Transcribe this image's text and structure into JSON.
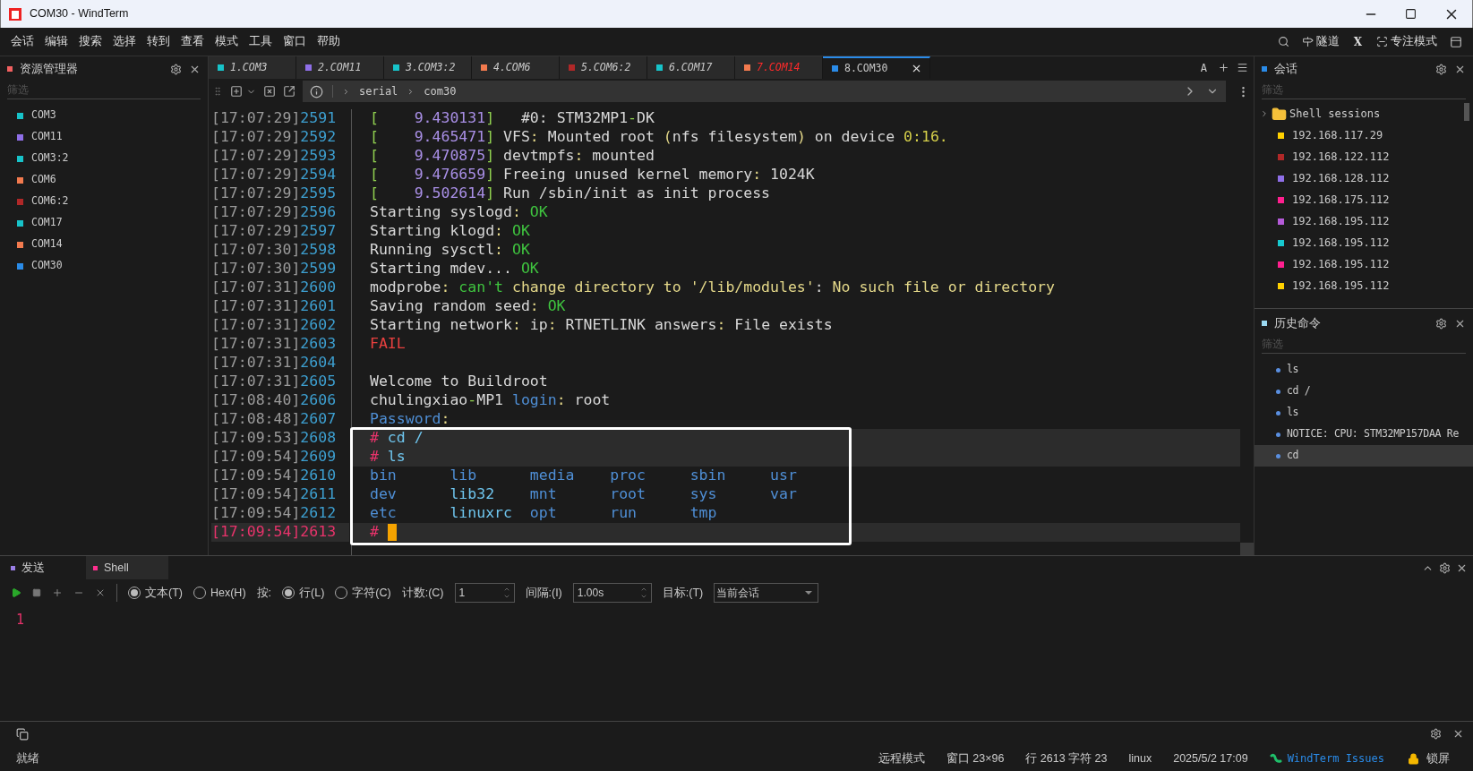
{
  "window": {
    "title": "COM30 - WindTerm"
  },
  "menu": [
    "会话",
    "编辑",
    "搜索",
    "选择",
    "转到",
    "查看",
    "模式",
    "工具",
    "窗口",
    "帮助"
  ],
  "menu_right": {
    "tunnel": "隧道",
    "x_label": "X",
    "focus_mode": "专注模式"
  },
  "explorer": {
    "title": "资源管理器",
    "filter_placeholder": "筛选",
    "items": [
      {
        "label": "COM3",
        "color": "#17c3c9"
      },
      {
        "label": "COM11",
        "color": "#8f6fe8"
      },
      {
        "label": "COM3:2",
        "color": "#17c3c9"
      },
      {
        "label": "COM6",
        "color": "#f27a4e"
      },
      {
        "label": "COM6:2",
        "color": "#b02828"
      },
      {
        "label": "COM17",
        "color": "#17c3c9"
      },
      {
        "label": "COM14",
        "color": "#f27a4e"
      },
      {
        "label": "COM30",
        "color": "#2a8be8"
      }
    ]
  },
  "tabs": [
    {
      "label": "1.COM3",
      "color": "#17c3c9",
      "selected": false,
      "alert": false
    },
    {
      "label": "2.COM11",
      "color": "#8f6fe8",
      "selected": false,
      "alert": false
    },
    {
      "label": "3.COM3:2",
      "color": "#17c3c9",
      "selected": false,
      "alert": false
    },
    {
      "label": "4.COM6",
      "color": "#f27a4e",
      "selected": false,
      "alert": false
    },
    {
      "label": "5.COM6:2",
      "color": "#b02828",
      "selected": false,
      "alert": false
    },
    {
      "label": "6.COM17",
      "color": "#17c3c9",
      "selected": false,
      "alert": false
    },
    {
      "label": "7.COM14",
      "color": "#f27a4e",
      "selected": false,
      "alert": true
    },
    {
      "label": "8.COM30",
      "color": "#2a8be8",
      "selected": true,
      "alert": false
    }
  ],
  "tabs_right": {
    "font_label": "A"
  },
  "breadcrumb": [
    "serial",
    "com30"
  ],
  "terminal": {
    "cursor_visible": true,
    "lines": [
      {
        "time": "[17:07:29]",
        "num": "2591",
        "highlighted": false,
        "current": false,
        "boxed": false,
        "segs": [
          {
            "text": "[",
            "color": "#8fcf4f"
          },
          {
            "text": "    9.430131",
            "color": "#a98fe6"
          },
          {
            "text": "]",
            "color": "#8fcf4f"
          },
          {
            "text": "   #0: STM32MP1",
            "color": "#d8d8d8"
          },
          {
            "text": "-",
            "color": "#8fcf4f"
          },
          {
            "text": "DK",
            "color": "#d8d8d8"
          }
        ]
      },
      {
        "time": "[17:07:29]",
        "num": "2592",
        "highlighted": false,
        "current": false,
        "boxed": false,
        "segs": [
          {
            "text": "[",
            "color": "#8fcf4f"
          },
          {
            "text": "    9.465471",
            "color": "#a98fe6"
          },
          {
            "text": "]",
            "color": "#8fcf4f"
          },
          {
            "text": " VFS",
            "color": "#d8d8d8"
          },
          {
            "text": ":",
            "color": "#e5d98a"
          },
          {
            "text": " Mounted root ",
            "color": "#d8d8d8"
          },
          {
            "text": "(",
            "color": "#e5d98a"
          },
          {
            "text": "nfs filesystem",
            "color": "#d8d8d8"
          },
          {
            "text": ")",
            "color": "#e5d98a"
          },
          {
            "text": " on device ",
            "color": "#d8d8d8"
          },
          {
            "text": "0:16.",
            "color": "#d6d04a"
          }
        ]
      },
      {
        "time": "[17:07:29]",
        "num": "2593",
        "highlighted": false,
        "current": false,
        "boxed": false,
        "segs": [
          {
            "text": "[",
            "color": "#8fcf4f"
          },
          {
            "text": "    9.470875",
            "color": "#a98fe6"
          },
          {
            "text": "]",
            "color": "#8fcf4f"
          },
          {
            "text": " devtmpfs",
            "color": "#d8d8d8"
          },
          {
            "text": ":",
            "color": "#e5d98a"
          },
          {
            "text": " mounted",
            "color": "#d8d8d8"
          }
        ]
      },
      {
        "time": "[17:07:29]",
        "num": "2594",
        "highlighted": false,
        "current": false,
        "boxed": false,
        "segs": [
          {
            "text": "[",
            "color": "#8fcf4f"
          },
          {
            "text": "    9.476659",
            "color": "#a98fe6"
          },
          {
            "text": "]",
            "color": "#8fcf4f"
          },
          {
            "text": " Freeing unused kernel memory",
            "color": "#d8d8d8"
          },
          {
            "text": ":",
            "color": "#e5d98a"
          },
          {
            "text": " 1024K",
            "color": "#d8d8d8"
          }
        ]
      },
      {
        "time": "[17:07:29]",
        "num": "2595",
        "highlighted": false,
        "current": false,
        "boxed": false,
        "segs": [
          {
            "text": "[",
            "color": "#8fcf4f"
          },
          {
            "text": "    9.502614",
            "color": "#a98fe6"
          },
          {
            "text": "]",
            "color": "#8fcf4f"
          },
          {
            "text": " Run /sbin/init as init process",
            "color": "#d8d8d8"
          }
        ]
      },
      {
        "time": "[17:07:29]",
        "num": "2596",
        "highlighted": false,
        "current": false,
        "boxed": false,
        "segs": [
          {
            "text": "Starting syslogd",
            "color": "#d8d8d8"
          },
          {
            "text": ":",
            "color": "#e5d98a"
          },
          {
            "text": " OK",
            "color": "#3fc43f"
          }
        ]
      },
      {
        "time": "[17:07:29]",
        "num": "2597",
        "highlighted": false,
        "current": false,
        "boxed": false,
        "segs": [
          {
            "text": "Starting klogd",
            "color": "#d8d8d8"
          },
          {
            "text": ":",
            "color": "#e5d98a"
          },
          {
            "text": " OK",
            "color": "#3fc43f"
          }
        ]
      },
      {
        "time": "[17:07:30]",
        "num": "2598",
        "highlighted": false,
        "current": false,
        "boxed": false,
        "segs": [
          {
            "text": "Running sysctl",
            "color": "#d8d8d8"
          },
          {
            "text": ":",
            "color": "#e5d98a"
          },
          {
            "text": " OK",
            "color": "#3fc43f"
          }
        ]
      },
      {
        "time": "[17:07:30]",
        "num": "2599",
        "highlighted": false,
        "current": false,
        "boxed": false,
        "segs": [
          {
            "text": "Starting mdev... ",
            "color": "#d8d8d8"
          },
          {
            "text": "OK",
            "color": "#3fc43f"
          }
        ]
      },
      {
        "time": "[17:07:31]",
        "num": "2600",
        "highlighted": false,
        "current": false,
        "boxed": false,
        "segs": [
          {
            "text": "modprobe",
            "color": "#d8d8d8"
          },
          {
            "text": ":",
            "color": "#e5d98a"
          },
          {
            "text": " can't",
            "color": "#3fc43f"
          },
          {
            "text": " change directory to '/lib/modules'",
            "color": "#e5d98a"
          },
          {
            "text": ":",
            "color": "#d8d8d8"
          },
          {
            "text": " No such file or directory",
            "color": "#e5d98a"
          }
        ]
      },
      {
        "time": "[17:07:31]",
        "num": "2601",
        "highlighted": false,
        "current": false,
        "boxed": false,
        "segs": [
          {
            "text": "Saving random seed",
            "color": "#d8d8d8"
          },
          {
            "text": ":",
            "color": "#e5d98a"
          },
          {
            "text": " OK",
            "color": "#3fc43f"
          }
        ]
      },
      {
        "time": "[17:07:31]",
        "num": "2602",
        "highlighted": false,
        "current": false,
        "boxed": false,
        "segs": [
          {
            "text": "Starting network",
            "color": "#d8d8d8"
          },
          {
            "text": ":",
            "color": "#e5d98a"
          },
          {
            "text": " ip",
            "color": "#d8d8d8"
          },
          {
            "text": ":",
            "color": "#e5d98a"
          },
          {
            "text": " RTNETLINK answers",
            "color": "#d8d8d8"
          },
          {
            "text": ":",
            "color": "#e5d98a"
          },
          {
            "text": " File exists",
            "color": "#d8d8d8"
          }
        ]
      },
      {
        "time": "[17:07:31]",
        "num": "2603",
        "highlighted": false,
        "current": false,
        "boxed": false,
        "segs": [
          {
            "text": "FAIL",
            "color": "#e8403f"
          }
        ]
      },
      {
        "time": "[17:07:31]",
        "num": "2604",
        "highlighted": false,
        "current": false,
        "boxed": false
      },
      {
        "time": "[17:07:31]",
        "num": "2605",
        "highlighted": false,
        "current": false,
        "boxed": false,
        "segs": [
          {
            "text": "Welcome to Buildroot",
            "color": "#d8d8d8"
          }
        ]
      },
      {
        "time": "[17:08:40]",
        "num": "2606",
        "highlighted": false,
        "current": false,
        "boxed": false,
        "segs": [
          {
            "text": "chulingxiao",
            "color": "#d8d8d8"
          },
          {
            "text": "-",
            "color": "#8fcf4f"
          },
          {
            "text": "MP1 ",
            "color": "#d8d8d8"
          },
          {
            "text": "login",
            "color": "#4f8fd6"
          },
          {
            "text": ":",
            "color": "#e5d98a"
          },
          {
            "text": " root",
            "color": "#d8d8d8"
          }
        ]
      },
      {
        "time": "[17:08:48]",
        "num": "2607",
        "highlighted": false,
        "current": false,
        "boxed": false,
        "segs": [
          {
            "text": "Password",
            "color": "#4f8fd6"
          },
          {
            "text": ":",
            "color": "#e5d98a"
          }
        ]
      },
      {
        "time": "[17:09:53]",
        "num": "2608",
        "highlighted": true,
        "current": false,
        "boxed": true,
        "segs": [
          {
            "text": "#",
            "color": "#e8336b"
          },
          {
            "text": " cd /",
            "color": "#6fc6ef"
          }
        ]
      },
      {
        "time": "[17:09:54]",
        "num": "2609",
        "highlighted": true,
        "current": false,
        "boxed": true,
        "segs": [
          {
            "text": "#",
            "color": "#e8336b"
          },
          {
            "text": " ls",
            "color": "#6fc6ef"
          }
        ]
      },
      {
        "time": "[17:09:54]",
        "num": "2610",
        "highlighted": false,
        "current": false,
        "boxed": true,
        "segs": [
          {
            "text": "bin      ",
            "color": "#4f8fd6"
          },
          {
            "text": "lib      ",
            "color": "#4f8fd6"
          },
          {
            "text": "media    ",
            "color": "#4f8fd6"
          },
          {
            "text": "proc     ",
            "color": "#4f8fd6"
          },
          {
            "text": "sbin     ",
            "color": "#4f8fd6"
          },
          {
            "text": "usr",
            "color": "#4f8fd6"
          }
        ]
      },
      {
        "time": "[17:09:54]",
        "num": "2611",
        "highlighted": false,
        "current": false,
        "boxed": true,
        "segs": [
          {
            "text": "dev      ",
            "color": "#4f8fd6"
          },
          {
            "text": "lib32    ",
            "color": "#6fc6ef"
          },
          {
            "text": "mnt      ",
            "color": "#4f8fd6"
          },
          {
            "text": "root     ",
            "color": "#4f8fd6"
          },
          {
            "text": "sys      ",
            "color": "#4f8fd6"
          },
          {
            "text": "var",
            "color": "#4f8fd6"
          }
        ]
      },
      {
        "time": "[17:09:54]",
        "num": "2612",
        "highlighted": false,
        "current": false,
        "boxed": true,
        "segs": [
          {
            "text": "etc      ",
            "color": "#4f8fd6"
          },
          {
            "text": "linuxrc  ",
            "color": "#6fc6ef"
          },
          {
            "text": "opt      ",
            "color": "#4f8fd6"
          },
          {
            "text": "run      ",
            "color": "#4f8fd6"
          },
          {
            "text": "tmp",
            "color": "#4f8fd6"
          }
        ]
      },
      {
        "time": "[17:09:54]",
        "num": "2613",
        "highlighted": true,
        "current": true,
        "boxed": true,
        "segs": [
          {
            "text": "#",
            "color": "#e8336b"
          }
        ]
      }
    ]
  },
  "sessions": {
    "title": "会话",
    "filter_placeholder": "筛选",
    "folder": {
      "label": "Shell sessions",
      "expanded": false
    },
    "items": [
      {
        "label": "192.168.117.29",
        "color": "#ffd000"
      },
      {
        "label": "192.168.122.112",
        "color": "#b02828"
      },
      {
        "label": "192.168.128.112",
        "color": "#8f6fe8"
      },
      {
        "label": "192.168.175.112",
        "color": "#ff1f8f"
      },
      {
        "label": "192.168.195.112",
        "color": "#b45ad8"
      },
      {
        "label": "192.168.195.112",
        "color": "#17c9cf"
      },
      {
        "label": "192.168.195.112",
        "color": "#ff1f8f"
      },
      {
        "label": "192.168.195.112",
        "color": "#ffd000"
      }
    ]
  },
  "history": {
    "title": "历史命令",
    "filter_placeholder": "筛选",
    "items": [
      {
        "label": "ls",
        "selected": false
      },
      {
        "label": "cd /",
        "selected": false
      },
      {
        "label": "ls",
        "selected": false
      },
      {
        "label": "NOTICE: CPU: STM32MP157DAA Re",
        "selected": false
      },
      {
        "label": "cd",
        "selected": true
      }
    ]
  },
  "send_panel": {
    "tabs": [
      {
        "label": "发送",
        "color": "#9a7fe6",
        "selected": true
      },
      {
        "label": "Shell",
        "color": "#ff2f8f",
        "selected": false
      }
    ],
    "mode_options": [
      {
        "label": "文本(T)",
        "checked": true
      },
      {
        "label": "Hex(H)",
        "checked": false
      }
    ],
    "by_label": "按:",
    "by_options": [
      {
        "label": "行(L)",
        "checked": true
      },
      {
        "label": "字符(C)",
        "checked": false
      }
    ],
    "count": {
      "label": "计数:(C)",
      "value": "1"
    },
    "interval": {
      "label": "间隔:(I)",
      "value": "1.00s"
    },
    "target": {
      "label": "目标:(T)",
      "value": "当前会话"
    },
    "editor_lines": [
      "1"
    ]
  },
  "status_bar": {
    "ready": "就绪",
    "items": [
      "远程模式",
      "窗口 23×96",
      "行 2613 字符 23",
      "linux",
      "2025/5/2 17:09"
    ],
    "issues_link": "WindTerm Issues",
    "lock": "锁屏"
  }
}
